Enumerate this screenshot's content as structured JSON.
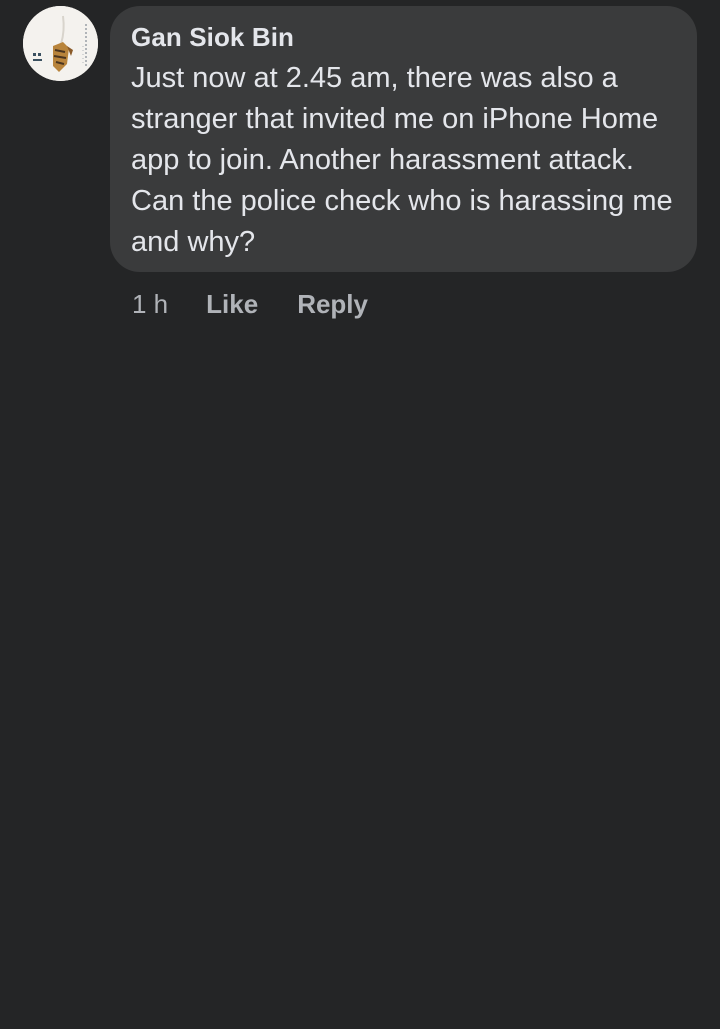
{
  "comment": {
    "author": "Gan Siok Bin",
    "text": "Just now at 2.45 am, there was also a stranger that invited me on iPhone Home app to join. Another harassment attack. Can the police check who is harassing me and why?",
    "timestamp": "1 h",
    "like_label": "Like",
    "reply_label": "Reply"
  },
  "colors": {
    "background": "#242526",
    "bubble": "#3a3b3c",
    "primary_text": "#e4e6eb",
    "secondary_text": "#b0b3b8"
  },
  "icons": {
    "avatar": "profile-picture"
  }
}
